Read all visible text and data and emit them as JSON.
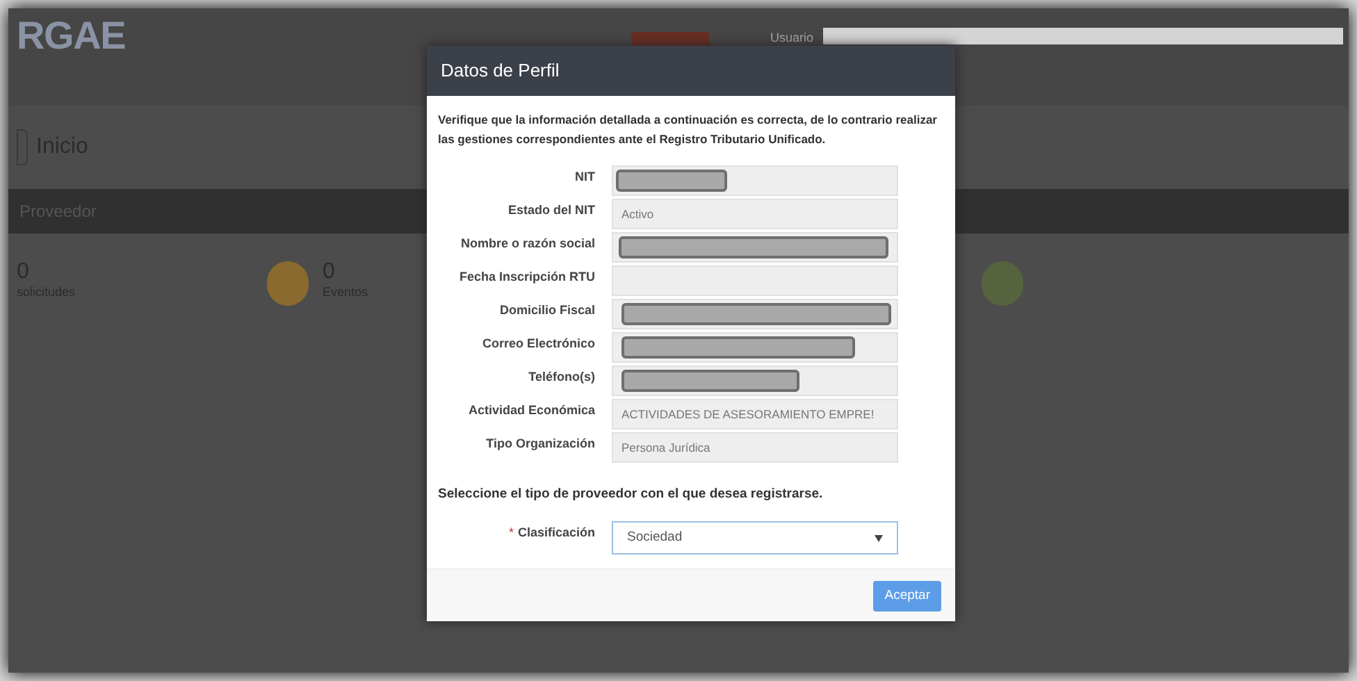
{
  "background": {
    "logo": "RGAE",
    "user_label": "Usuario",
    "page_title": "Inicio",
    "section_title": "Proveedor",
    "stats": [
      {
        "count": "0",
        "label": "solicitudes"
      },
      {
        "count": "0",
        "label": "Eventos",
        "color": "#8a6a2e"
      },
      {
        "color": "#56633f"
      }
    ]
  },
  "modal": {
    "title": "Datos de Perfil",
    "intro": "Verifique que la información detallada a continuación es correcta, de lo contrario realizar las gestiones correspondientes ante el Registro Tributario Unificado.",
    "fields": [
      {
        "label": "NIT",
        "kind": "redacted"
      },
      {
        "label": "Estado del NIT",
        "kind": "text",
        "value": "Activo"
      },
      {
        "label": "Nombre o razón social",
        "kind": "redacted"
      },
      {
        "label": "Fecha Inscripción RTU",
        "kind": "text"
      },
      {
        "label": "Domicilio Fiscal",
        "kind": "redacted"
      },
      {
        "label": "Correo Electrónico",
        "kind": "redacted"
      },
      {
        "label": "Teléfono(s)",
        "kind": "redacted"
      },
      {
        "label": "Actividad Económica",
        "kind": "text",
        "value": "ACTIVIDADES DE ASESORAMIENTO EMPRE!"
      },
      {
        "label": "Tipo Organización",
        "kind": "text",
        "value": "Persona Jurídica"
      }
    ],
    "prompt": "Seleccione el tipo de proveedor con el que desea registrarse.",
    "select": {
      "required_mark": "*",
      "label": "Clasificación",
      "value": "Sociedad"
    },
    "accept_button": "Aceptar"
  }
}
